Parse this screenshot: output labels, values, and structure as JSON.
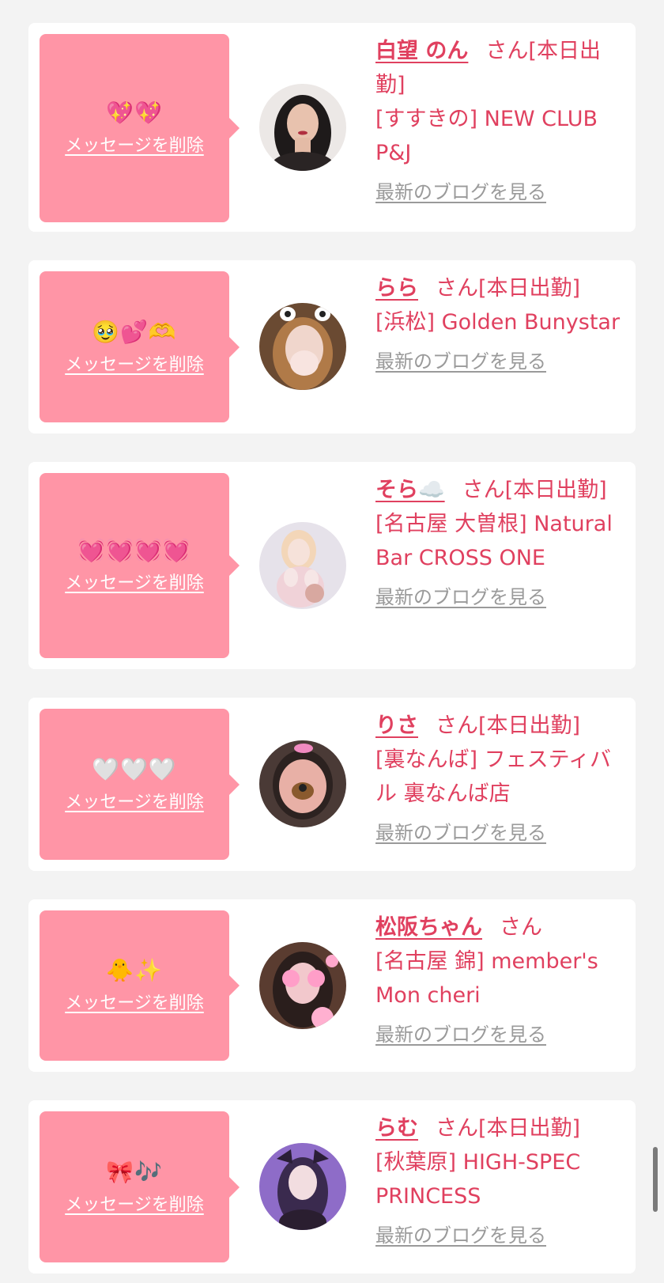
{
  "cards": [
    {
      "emoji": "💖💖",
      "delete_label": "メッセージを削除",
      "name": "白望 のん",
      "honorific": "さん",
      "status": "[本日出勤]",
      "shop": "[すすきの] NEW CLUB P&J",
      "blog_label": "最新のブログを見る"
    },
    {
      "emoji": "🥹💕🫶",
      "delete_label": "メッセージを削除",
      "name": "らら",
      "honorific": "さん",
      "status": "[本日出勤]",
      "shop": "[浜松] Golden Bunystar",
      "blog_label": "最新のブログを見る"
    },
    {
      "emoji": "💓💓💓💓",
      "delete_label": "メッセージを削除",
      "name": "そら☁️",
      "honorific": "さん",
      "status": "[本日出勤]",
      "shop": "[名古屋 大曽根] Natural Bar CROSS ONE",
      "blog_label": "最新のブログを見る"
    },
    {
      "emoji": "🤍🤍🤍",
      "delete_label": "メッセージを削除",
      "name": "りさ",
      "honorific": "さん",
      "status": "[本日出勤]",
      "shop": "[裏なんば] フェスティバル 裏なんば店",
      "blog_label": "最新のブログを見る"
    },
    {
      "emoji": "🐥✨",
      "delete_label": "メッセージを削除",
      "name": "松阪ちゃん",
      "honorific": "さん",
      "status": "",
      "shop": "[名古屋 錦] member's Mon cheri",
      "blog_label": "最新のブログを見る"
    },
    {
      "emoji": "🎀🎶",
      "delete_label": "メッセージを削除",
      "name": "らむ",
      "honorific": "さん",
      "status": "[本日出勤]",
      "shop": "[秋葉原] HIGH-SPEC PRINCESS",
      "blog_label": "最新のブログを見る"
    }
  ],
  "colors": {
    "accent": "#e0405f",
    "bubble": "#ff95a6",
    "background": "#f3f3f3",
    "link_gray": "#9a9a9a"
  }
}
